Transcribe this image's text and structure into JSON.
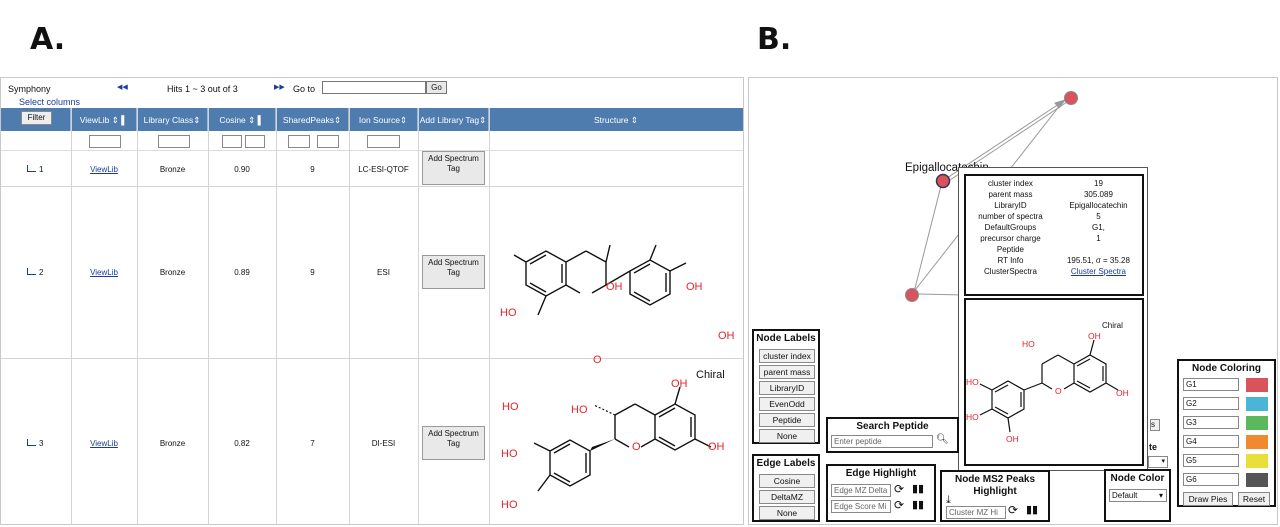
{
  "labels": {
    "a": "A.",
    "b": "B."
  },
  "panel_a": {
    "app": "Symphony",
    "select_columns": "Select columns",
    "nav_prev": "◀◀",
    "nav_next": "▶▶",
    "hits": "Hits 1 ~ 3 out of 3",
    "goto": "Go to",
    "go": "Go",
    "filter": "Filter",
    "headers": [
      "ViewLib",
      "Library Class",
      "Cosine",
      "SharedPeaks",
      "Ion Source",
      "Add Library Tag",
      "Structure"
    ],
    "rows": [
      {
        "num": "1",
        "view": "ViewLib",
        "cls": "Bronze",
        "cos": "0.90",
        "peaks": "9",
        "src": "LC-ESI-QTOF",
        "btn": "Add Spectrum Tag"
      },
      {
        "num": "2",
        "view": "ViewLib",
        "cls": "Bronze",
        "cos": "0.89",
        "peaks": "9",
        "src": "ESI",
        "btn": "Add Spectrum Tag"
      },
      {
        "num": "3",
        "view": "ViewLib",
        "cls": "Bronze",
        "cos": "0.82",
        "peaks": "7",
        "src": "DI-ESI",
        "btn": "Add Spectrum Tag"
      }
    ],
    "struct_labels": {
      "oh": "OH",
      "ho": "HO",
      "o": "O",
      "chiral": "Chiral"
    }
  },
  "panel_b": {
    "node_name": "Epigallocatechin",
    "tooltip": [
      [
        "cluster index",
        "19"
      ],
      [
        "parent mass",
        "305.089"
      ],
      [
        "LibraryID",
        "Epigallocatechin"
      ],
      [
        "number of spectra",
        "5"
      ],
      [
        "DefaultGroups",
        "G1,"
      ],
      [
        "precursor charge",
        "1"
      ],
      [
        "Peptide",
        ""
      ],
      [
        "RT Info",
        "195.51, σ = 35.28"
      ],
      [
        "ClusterSpectra",
        "Cluster Spectra"
      ]
    ],
    "chiral": "Chiral",
    "node_labels": {
      "title": "Node Labels",
      "items": [
        "cluster index",
        "parent mass",
        "LibraryID",
        "EvenOdd",
        "Peptide",
        "None"
      ]
    },
    "edge_labels": {
      "title": "Edge Labels",
      "items": [
        "Cosine",
        "DeltaMZ",
        "None"
      ]
    },
    "search": {
      "title": "Search Peptide",
      "placeholder": "Enter peptide"
    },
    "edge_highlight": {
      "title": "Edge Highlight",
      "in1": "Edge MZ Delta",
      "in2": "Edge Score Mi"
    },
    "ms2": {
      "title1": "Node MS2 Peaks",
      "title2": "Highlight",
      "in": "Cluster MZ Hi"
    },
    "node_color": {
      "title": "Node Color",
      "value": "Default",
      "partial": "te",
      "partial2": "s"
    },
    "node_coloring": {
      "title": "Node Coloring",
      "groups": [
        "G1",
        "G2",
        "G3",
        "G4",
        "G5",
        "G6"
      ],
      "colors": [
        "#d9535d",
        "#4ab5d6",
        "#5cb85c",
        "#ef8a2e",
        "#e8df3a",
        "#555555"
      ],
      "draw": "Draw Pies",
      "reset": "Reset"
    }
  }
}
